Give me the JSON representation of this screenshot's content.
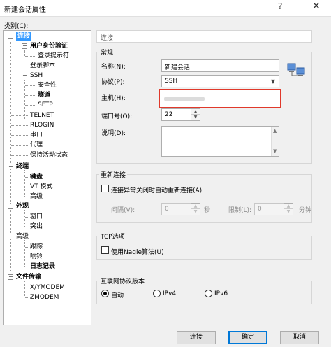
{
  "window": {
    "title": "新建会话属性",
    "help": "?",
    "close": "✕"
  },
  "category_label": "类别(C):",
  "tree": {
    "items": [
      {
        "label": "连接",
        "bold": true,
        "selected": true
      },
      {
        "label": "用户身份验证",
        "bold": true
      },
      {
        "label": "登录提示符"
      },
      {
        "label": "登录脚本"
      },
      {
        "label": "SSH"
      },
      {
        "label": "安全性"
      },
      {
        "label": "隧道",
        "bold": true
      },
      {
        "label": "SFTP"
      },
      {
        "label": "TELNET"
      },
      {
        "label": "RLOGIN"
      },
      {
        "label": "串口"
      },
      {
        "label": "代理"
      },
      {
        "label": "保持活动状态"
      },
      {
        "label": "终端",
        "bold": true
      },
      {
        "label": "键盘",
        "bold": true
      },
      {
        "label": "VT 模式"
      },
      {
        "label": "高级"
      },
      {
        "label": "外观",
        "bold": true
      },
      {
        "label": "窗口"
      },
      {
        "label": "突出"
      },
      {
        "label": "高级"
      },
      {
        "label": "跟踪"
      },
      {
        "label": "响铃"
      },
      {
        "label": "日志记录",
        "bold": true
      },
      {
        "label": "文件传输",
        "bold": true
      },
      {
        "label": "X/YMODEM"
      },
      {
        "label": "ZMODEM"
      }
    ]
  },
  "panel": {
    "header": "连接",
    "general": {
      "legend": "常规",
      "name_label": "名称(N):",
      "name_value": "新建会话",
      "protocol_label": "协议(P):",
      "protocol_value": "SSH",
      "host_label": "主机(H):",
      "host_value": "",
      "port_label": "端口号(O):",
      "port_value": "22",
      "desc_label": "说明(D):",
      "desc_value": ""
    },
    "reconnect": {
      "legend": "重新连接",
      "checkbox_label": "连接异常关闭时自动重新连接(A)",
      "interval_label": "间隔(V):",
      "interval_value": "0",
      "seconds_unit": "秒",
      "limit_label": "限制(L):",
      "limit_value": "0",
      "minutes_unit": "分钟"
    },
    "tcp": {
      "legend": "TCP选项",
      "nagle_label": "使用Nagle算法(U)"
    },
    "ip": {
      "legend": "互联网协议版本",
      "auto_label": "自动",
      "ipv4_label": "IPv4",
      "ipv6_label": "IPv6"
    }
  },
  "buttons": {
    "connect": "连接",
    "ok": "确定",
    "cancel": "取消"
  }
}
